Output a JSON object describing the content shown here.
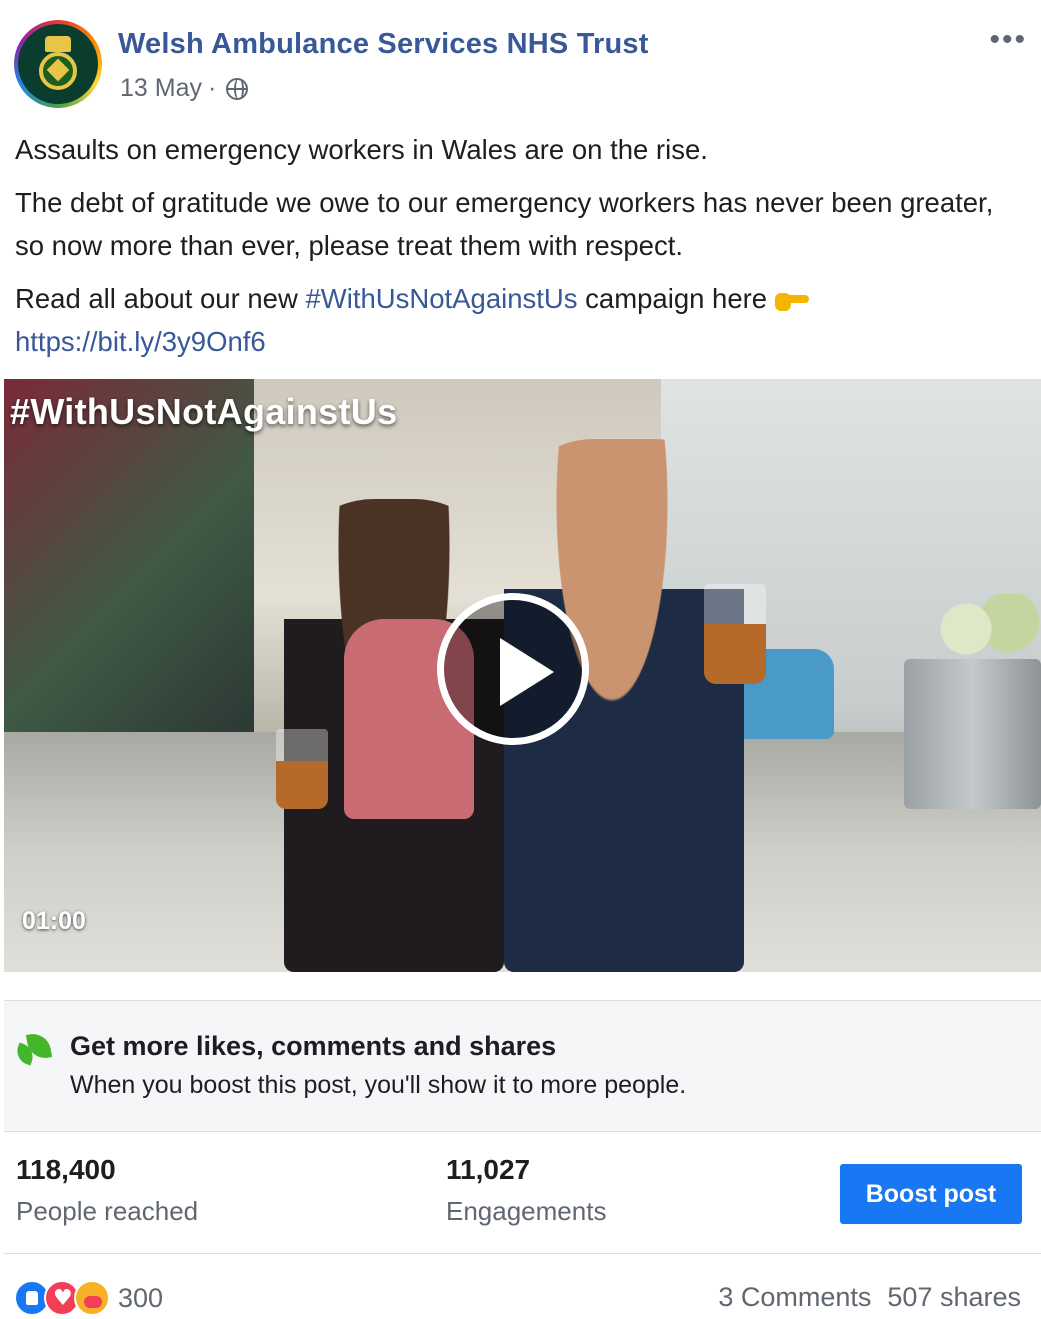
{
  "post": {
    "page_name": "Welsh Ambulance Services NHS Trust",
    "date": "13 May",
    "separator": "·",
    "more_label": "•••",
    "text": {
      "p1": "Assaults on emergency workers in Wales are on the rise.",
      "p2": "The debt of gratitude we owe to our emergency workers has never been greater, so now more than ever, please treat them with respect.",
      "p3_prefix": "Read all about our new",
      "p3_hashtag": "#WithUsNotAgainstUs",
      "p3_suffix": "campaign here",
      "link": "https://bit.ly/3y9Onf6"
    }
  },
  "video": {
    "overlay_hashtag": "#WithUsNotAgainstUs",
    "duration": "01:00"
  },
  "boost_promo": {
    "title": "Get more likes, comments and shares",
    "subtitle": "When you boost this post, you'll show it to more people."
  },
  "stats": {
    "reached_value": "118,400",
    "reached_label": "People reached",
    "engagements_value": "11,027",
    "engagements_label": "Engagements",
    "boost_button": "Boost post"
  },
  "footer": {
    "reaction_count": "300",
    "comments": "3 Comments",
    "shares": "507 shares"
  },
  "icons": {
    "privacy": "globe-icon",
    "pointing": "backhand-index-pointing-right-icon",
    "reactions": [
      "like-icon",
      "love-icon",
      "care-icon"
    ],
    "promo": "leaf-check-icon"
  },
  "colors": {
    "link": "#385898",
    "boost_button": "#1877f2",
    "promo_background": "#f5f6f7"
  }
}
